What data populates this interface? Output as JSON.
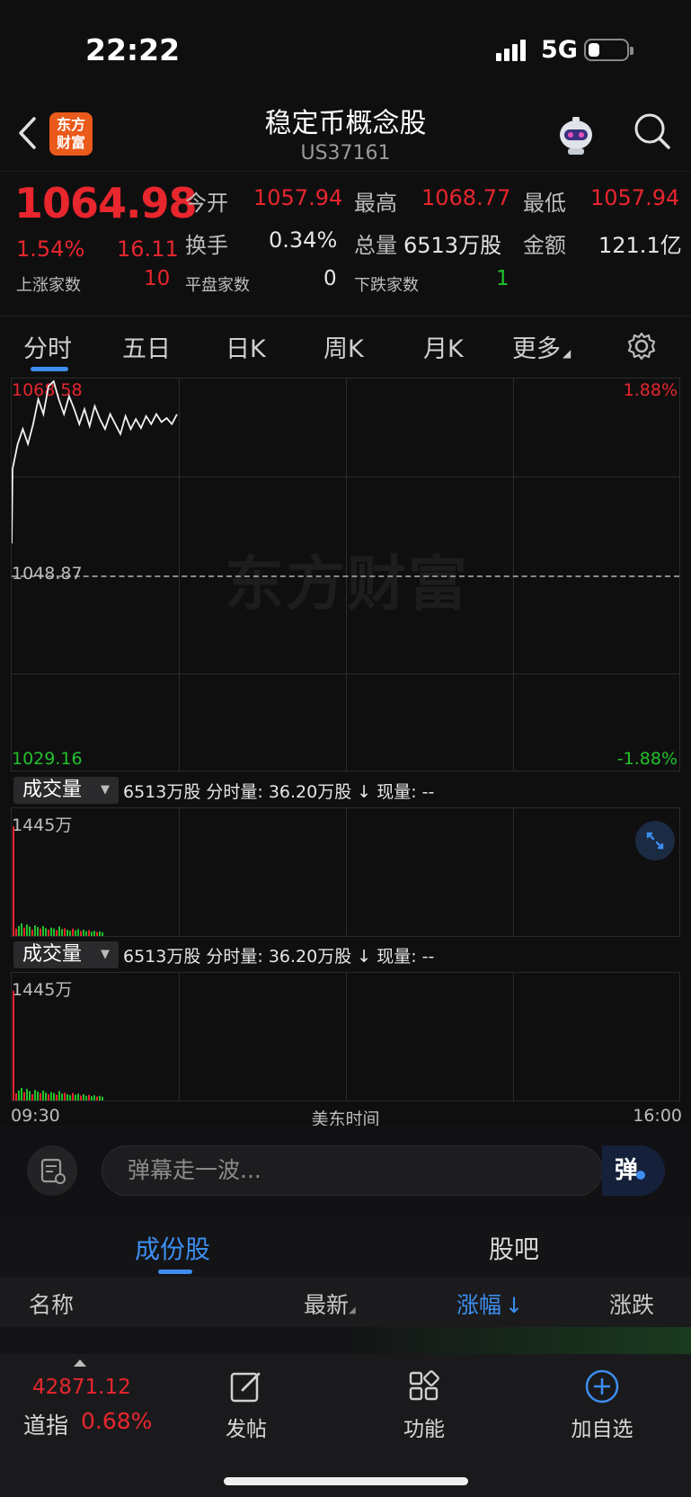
{
  "status": {
    "time": "22:22",
    "network": "5G"
  },
  "nav": {
    "logo_line1": "东方",
    "logo_line2": "财富",
    "title": "稳定币概念股",
    "code": "US37161"
  },
  "quote": {
    "price": "1064.98",
    "change_pct": "1.54%",
    "change": "16.11",
    "open_label": "今开",
    "open": "1057.94",
    "high_label": "最高",
    "high": "1068.77",
    "low_label": "最低",
    "low": "1057.94",
    "turnover_label": "换手",
    "turnover": "0.34%",
    "volume_label": "总量",
    "volume": "6513万股",
    "amount_label": "金额",
    "amount": "121.1亿",
    "up_label": "上涨家数",
    "up_count": "10",
    "flat_label": "平盘家数",
    "flat_count": "0",
    "down_label": "下跌家数",
    "down_count": "1"
  },
  "tabs": [
    "分时",
    "五日",
    "日K",
    "周K",
    "月K",
    "更多"
  ],
  "chart": {
    "price_top": "1068.58",
    "price_mid": "1048.87",
    "price_bottom": "1029.16",
    "pct_top": "1.88%",
    "pct_bottom": "-1.88%",
    "watermark": "东方财富",
    "intraday_prices": [
      1059.5,
      1062.0,
      1063.5,
      1062.0,
      1064.0,
      1066.5,
      1065.0,
      1067.8,
      1068.3,
      1066.5,
      1065.0,
      1066.8,
      1065.5,
      1064.0,
      1065.5,
      1063.8,
      1065.8,
      1064.5,
      1063.5,
      1065.0,
      1064.0,
      1063.0,
      1064.8,
      1063.5,
      1064.5,
      1063.6,
      1064.8,
      1064.0,
      1065.0,
      1064.2,
      1064.6,
      1064.0,
      1064.98
    ]
  },
  "volume_panel_1": {
    "selector": "成交量",
    "summary": "6513万股 分时量: 36.20万股 ↓ 现量: --",
    "max_label": "1445万"
  },
  "volume_panel_2": {
    "selector": "成交量",
    "summary": "6513万股 分时量: 36.20万股 ↓ 现量: --",
    "max_label": "1445万"
  },
  "volume_bars": [
    1445,
    70,
    95,
    120,
    80,
    110,
    90,
    60,
    100,
    85,
    70,
    95,
    75,
    60,
    80,
    70,
    55,
    90,
    65,
    75,
    60,
    50,
    70,
    55,
    65,
    48,
    60,
    45,
    55,
    40,
    50,
    38,
    45,
    36
  ],
  "xaxis": {
    "start": "09:30",
    "middle": "美东时间",
    "end": "16:00"
  },
  "danmaku": {
    "placeholder": "弹幕走一波...",
    "button": "弹"
  },
  "subtabs": {
    "components": "成份股",
    "forum": "股吧"
  },
  "list_header": {
    "name": "名称",
    "latest": "最新",
    "change_pct": "涨幅",
    "change": "涨跌"
  },
  "tabbar": {
    "index_value": "42871.12",
    "index_name": "道指",
    "index_pct": "0.68%",
    "post": "发帖",
    "functions": "功能",
    "add_watch": "加自选"
  },
  "colors": {
    "up": "#e8262d",
    "down": "#22c12d",
    "accent": "#3d8ef0"
  }
}
